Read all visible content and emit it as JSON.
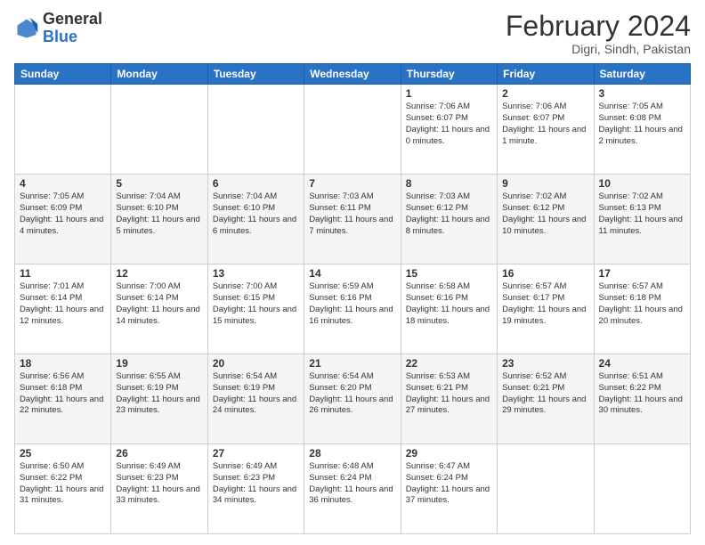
{
  "header": {
    "logo_general": "General",
    "logo_blue": "Blue",
    "title": "February 2024",
    "subtitle": "Digri, Sindh, Pakistan"
  },
  "days_of_week": [
    "Sunday",
    "Monday",
    "Tuesday",
    "Wednesday",
    "Thursday",
    "Friday",
    "Saturday"
  ],
  "weeks": [
    [
      {
        "day": "",
        "info": ""
      },
      {
        "day": "",
        "info": ""
      },
      {
        "day": "",
        "info": ""
      },
      {
        "day": "",
        "info": ""
      },
      {
        "day": "1",
        "info": "Sunrise: 7:06 AM\nSunset: 6:07 PM\nDaylight: 11 hours\nand 0 minutes."
      },
      {
        "day": "2",
        "info": "Sunrise: 7:06 AM\nSunset: 6:07 PM\nDaylight: 11 hours\nand 1 minute."
      },
      {
        "day": "3",
        "info": "Sunrise: 7:05 AM\nSunset: 6:08 PM\nDaylight: 11 hours\nand 2 minutes."
      }
    ],
    [
      {
        "day": "4",
        "info": "Sunrise: 7:05 AM\nSunset: 6:09 PM\nDaylight: 11 hours\nand 4 minutes."
      },
      {
        "day": "5",
        "info": "Sunrise: 7:04 AM\nSunset: 6:10 PM\nDaylight: 11 hours\nand 5 minutes."
      },
      {
        "day": "6",
        "info": "Sunrise: 7:04 AM\nSunset: 6:10 PM\nDaylight: 11 hours\nand 6 minutes."
      },
      {
        "day": "7",
        "info": "Sunrise: 7:03 AM\nSunset: 6:11 PM\nDaylight: 11 hours\nand 7 minutes."
      },
      {
        "day": "8",
        "info": "Sunrise: 7:03 AM\nSunset: 6:12 PM\nDaylight: 11 hours\nand 8 minutes."
      },
      {
        "day": "9",
        "info": "Sunrise: 7:02 AM\nSunset: 6:12 PM\nDaylight: 11 hours\nand 10 minutes."
      },
      {
        "day": "10",
        "info": "Sunrise: 7:02 AM\nSunset: 6:13 PM\nDaylight: 11 hours\nand 11 minutes."
      }
    ],
    [
      {
        "day": "11",
        "info": "Sunrise: 7:01 AM\nSunset: 6:14 PM\nDaylight: 11 hours\nand 12 minutes."
      },
      {
        "day": "12",
        "info": "Sunrise: 7:00 AM\nSunset: 6:14 PM\nDaylight: 11 hours\nand 14 minutes."
      },
      {
        "day": "13",
        "info": "Sunrise: 7:00 AM\nSunset: 6:15 PM\nDaylight: 11 hours\nand 15 minutes."
      },
      {
        "day": "14",
        "info": "Sunrise: 6:59 AM\nSunset: 6:16 PM\nDaylight: 11 hours\nand 16 minutes."
      },
      {
        "day": "15",
        "info": "Sunrise: 6:58 AM\nSunset: 6:16 PM\nDaylight: 11 hours\nand 18 minutes."
      },
      {
        "day": "16",
        "info": "Sunrise: 6:57 AM\nSunset: 6:17 PM\nDaylight: 11 hours\nand 19 minutes."
      },
      {
        "day": "17",
        "info": "Sunrise: 6:57 AM\nSunset: 6:18 PM\nDaylight: 11 hours\nand 20 minutes."
      }
    ],
    [
      {
        "day": "18",
        "info": "Sunrise: 6:56 AM\nSunset: 6:18 PM\nDaylight: 11 hours\nand 22 minutes."
      },
      {
        "day": "19",
        "info": "Sunrise: 6:55 AM\nSunset: 6:19 PM\nDaylight: 11 hours\nand 23 minutes."
      },
      {
        "day": "20",
        "info": "Sunrise: 6:54 AM\nSunset: 6:19 PM\nDaylight: 11 hours\nand 24 minutes."
      },
      {
        "day": "21",
        "info": "Sunrise: 6:54 AM\nSunset: 6:20 PM\nDaylight: 11 hours\nand 26 minutes."
      },
      {
        "day": "22",
        "info": "Sunrise: 6:53 AM\nSunset: 6:21 PM\nDaylight: 11 hours\nand 27 minutes."
      },
      {
        "day": "23",
        "info": "Sunrise: 6:52 AM\nSunset: 6:21 PM\nDaylight: 11 hours\nand 29 minutes."
      },
      {
        "day": "24",
        "info": "Sunrise: 6:51 AM\nSunset: 6:22 PM\nDaylight: 11 hours\nand 30 minutes."
      }
    ],
    [
      {
        "day": "25",
        "info": "Sunrise: 6:50 AM\nSunset: 6:22 PM\nDaylight: 11 hours\nand 31 minutes."
      },
      {
        "day": "26",
        "info": "Sunrise: 6:49 AM\nSunset: 6:23 PM\nDaylight: 11 hours\nand 33 minutes."
      },
      {
        "day": "27",
        "info": "Sunrise: 6:49 AM\nSunset: 6:23 PM\nDaylight: 11 hours\nand 34 minutes."
      },
      {
        "day": "28",
        "info": "Sunrise: 6:48 AM\nSunset: 6:24 PM\nDaylight: 11 hours\nand 36 minutes."
      },
      {
        "day": "29",
        "info": "Sunrise: 6:47 AM\nSunset: 6:24 PM\nDaylight: 11 hours\nand 37 minutes."
      },
      {
        "day": "",
        "info": ""
      },
      {
        "day": "",
        "info": ""
      }
    ]
  ]
}
